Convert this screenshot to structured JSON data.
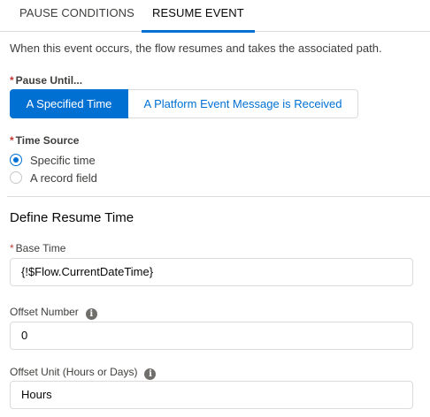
{
  "tabs": [
    {
      "label": "PAUSE CONDITIONS",
      "active": false
    },
    {
      "label": "RESUME EVENT",
      "active": true
    }
  ],
  "description": "When this event occurs, the flow resumes and takes the associated path.",
  "pause_until": {
    "required_mark": "*",
    "label": "Pause Until...",
    "options": [
      "A Specified Time",
      "A Platform Event Message is Received"
    ],
    "selected": "A Specified Time"
  },
  "time_source": {
    "required_mark": "*",
    "label": "Time Source",
    "options": [
      "Specific time",
      "A record field"
    ],
    "selected": "Specific time"
  },
  "section_title": "Define Resume Time",
  "base_time": {
    "required_mark": "*",
    "label": "Base Time",
    "value": "{!$Flow.CurrentDateTime}"
  },
  "offset_number": {
    "label": "Offset Number",
    "value": "0",
    "info_icon": "info-icon"
  },
  "offset_unit": {
    "label": "Offset Unit (Hours or Days)",
    "value": "Hours",
    "info_icon": "info-icon"
  },
  "colors": {
    "brand": "#0070d2",
    "required": "#c23934",
    "border": "#dddbda"
  }
}
